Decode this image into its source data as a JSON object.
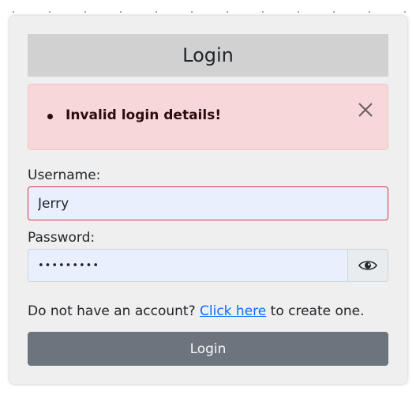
{
  "title": "Login",
  "alert": {
    "messages": [
      "Invalid login details!"
    ]
  },
  "form": {
    "username_label": "Username:",
    "username_value": "Jerry",
    "password_label": "Password:",
    "password_value": "•••••••••"
  },
  "signup": {
    "prefix": "Do not have an account?",
    "link_label": "Click here",
    "suffix": "to create one."
  },
  "login_button_label": "Login",
  "colors": {
    "card_bg": "#efefef",
    "header_bg": "#d1d1d1",
    "alert_bg": "#f8d7da",
    "input_bg": "#e8f0fe",
    "invalid_border": "#dc3545",
    "link": "#0d6efd",
    "button_bg": "#6c757d"
  },
  "icons": {
    "alert_close": "close-icon",
    "password_toggle": "eye-icon"
  }
}
